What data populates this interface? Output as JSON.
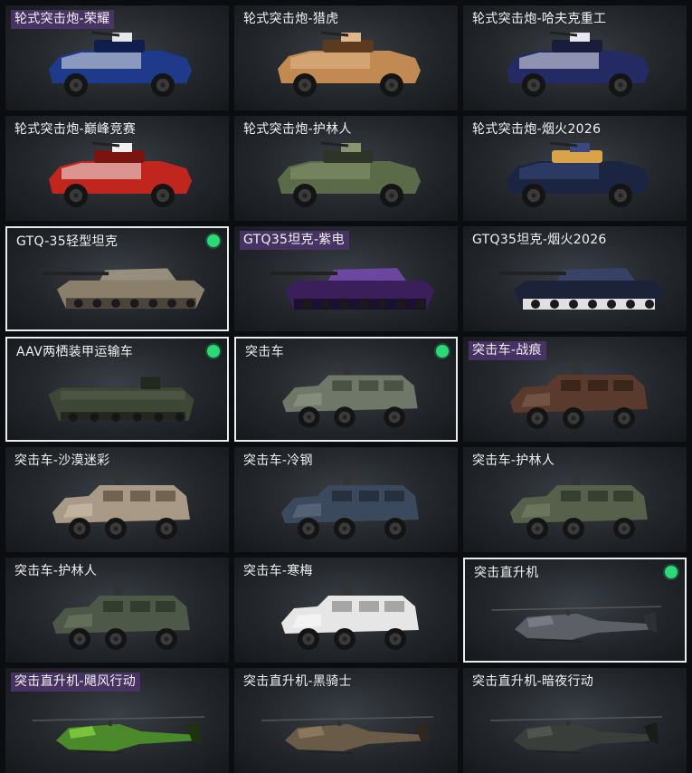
{
  "colors": {
    "background": "#0b0d10",
    "title_highlight": "#4a3468",
    "selected_border": "#e9ecef",
    "owned_indicator": "#2bd977"
  },
  "vehicles": [
    {
      "name": "轮式突击炮-荣耀",
      "type": "wheeled",
      "palette": [
        "#1f3a8a",
        "#e5e7eb",
        "#0f1e4d"
      ],
      "title_style": "purple",
      "selected": false,
      "owned": false
    },
    {
      "name": "轮式突击炮-猎虎",
      "type": "wheeled",
      "palette": [
        "#c08a52",
        "#e0b98a",
        "#5a3b1f"
      ],
      "title_style": "plain",
      "selected": false,
      "owned": false
    },
    {
      "name": "轮式突击炮-哈夫克重工",
      "type": "wheeled",
      "palette": [
        "#242a63",
        "#e8e8f0",
        "#1a1d3a"
      ],
      "title_style": "plain",
      "selected": false,
      "owned": false
    },
    {
      "name": "轮式突击炮-巅峰竞赛",
      "type": "wheeled",
      "palette": [
        "#c0261e",
        "#f0f0f0",
        "#7a1410"
      ],
      "title_style": "plain",
      "selected": false,
      "owned": false
    },
    {
      "name": "轮式突击炮-护林人",
      "type": "wheeled",
      "palette": [
        "#5b6b4a",
        "#8a9670",
        "#2e3526"
      ],
      "title_style": "plain",
      "selected": false,
      "owned": false
    },
    {
      "name": "轮式突击炮-烟火2026",
      "type": "wheeled",
      "palette": [
        "#1b2440",
        "#3a4a80",
        "#d9a34a"
      ],
      "title_style": "plain",
      "selected": false,
      "owned": false
    },
    {
      "name": "GTQ-35轻型坦克",
      "type": "tank",
      "palette": [
        "#8a7f6a",
        "#b0a58e",
        "#4a443a"
      ],
      "title_style": "plain",
      "selected": true,
      "owned": true
    },
    {
      "name": "GTQ35坦克-紫电",
      "type": "tank",
      "palette": [
        "#3b1f5a",
        "#7a4bb8",
        "#1c1030"
      ],
      "title_style": "purple",
      "selected": false,
      "owned": false
    },
    {
      "name": "GTQ35坦克-烟火2026",
      "type": "tank",
      "palette": [
        "#1c2238",
        "#3a4570",
        "#e0e0e0"
      ],
      "title_style": "plain",
      "selected": false,
      "owned": false
    },
    {
      "name": "AAV两栖装甲运输车",
      "type": "aav",
      "palette": [
        "#3e4636",
        "#5a6450",
        "#23281f"
      ],
      "title_style": "plain",
      "selected": true,
      "owned": true
    },
    {
      "name": "突击车",
      "type": "truck",
      "palette": [
        "#6f7868",
        "#9aa290",
        "#3a4036"
      ],
      "title_style": "plain",
      "selected": true,
      "owned": true
    },
    {
      "name": "突击车-战痕",
      "type": "truck",
      "palette": [
        "#5a3a2c",
        "#8a6a5a",
        "#2e1e16"
      ],
      "title_style": "purple",
      "selected": false,
      "owned": false
    },
    {
      "name": "突击车-沙漠迷彩",
      "type": "truck",
      "palette": [
        "#a89a86",
        "#d6cbb8",
        "#5a4a3c"
      ],
      "title_style": "plain",
      "selected": false,
      "owned": false
    },
    {
      "name": "突击车-冷钢",
      "type": "truck",
      "palette": [
        "#3a4a5c",
        "#6a7a8c",
        "#1e2630"
      ],
      "title_style": "plain",
      "selected": false,
      "owned": false
    },
    {
      "name": "突击车-护林人",
      "type": "truck",
      "palette": [
        "#56604a",
        "#7e8a6e",
        "#2c3226"
      ],
      "title_style": "plain",
      "selected": false,
      "owned": false
    },
    {
      "name": "突击车-护林人",
      "type": "truck",
      "palette": [
        "#4e5848",
        "#78846a",
        "#2a3024"
      ],
      "title_style": "plain",
      "selected": false,
      "owned": false
    },
    {
      "name": "突击车-寒梅",
      "type": "truck",
      "palette": [
        "#e6e6e6",
        "#ffffff",
        "#8a8a8a"
      ],
      "title_style": "plain",
      "selected": false,
      "owned": false
    },
    {
      "name": "突击直升机",
      "type": "heli",
      "palette": [
        "#5c6066",
        "#8a8e94",
        "#2e3034"
      ],
      "title_style": "plain",
      "selected": true,
      "owned": true
    },
    {
      "name": "突击直升机-飓风行动",
      "type": "heli",
      "palette": [
        "#4a8a2a",
        "#9be84a",
        "#1e3210"
      ],
      "title_style": "purple",
      "selected": false,
      "owned": false
    },
    {
      "name": "突击直升机-黑骑士",
      "type": "heli",
      "palette": [
        "#6a5a48",
        "#a08868",
        "#2e2620"
      ],
      "title_style": "plain",
      "selected": false,
      "owned": false
    },
    {
      "name": "突击直升机-暗夜行动",
      "type": "heli",
      "palette": [
        "#3a3e3a",
        "#5e645e",
        "#1a1c1a"
      ],
      "title_style": "plain",
      "selected": false,
      "owned": false
    }
  ]
}
